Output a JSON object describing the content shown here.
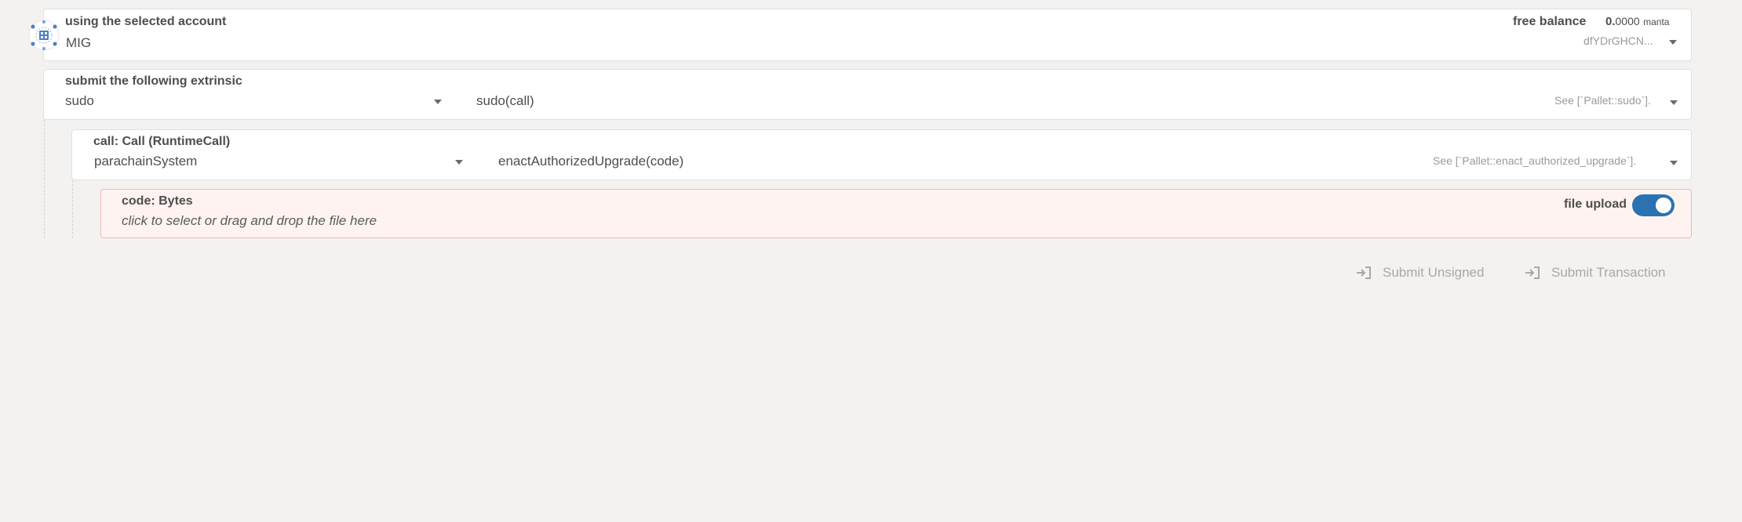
{
  "account": {
    "label": "using the selected account",
    "name": "MIG",
    "balance_label": "free balance",
    "balance_int": "0.",
    "balance_frac": "0000",
    "balance_unit": "manta",
    "address": "dfYDrGHCN..."
  },
  "extrinsic": {
    "label": "submit the following extrinsic",
    "pallet": "sudo",
    "method": "sudo(call)",
    "doc_hint": "See [`Pallet::sudo`]."
  },
  "call": {
    "label": "call: Call (RuntimeCall)",
    "pallet": "parachainSystem",
    "method": "enactAuthorizedUpgrade(code)",
    "doc_hint": "See [`Pallet::enact_authorized_upgrade`]."
  },
  "code": {
    "label": "code: Bytes",
    "placeholder": "click to select or drag and drop the file here",
    "toggle_label": "file upload",
    "toggle_on": true
  },
  "actions": {
    "submit_unsigned": "Submit Unsigned",
    "submit_transaction": "Submit Transaction"
  },
  "colors": {
    "accent": "#2c72b3",
    "error_bg": "#fef3f1",
    "error_border": "#f0b9b3"
  }
}
